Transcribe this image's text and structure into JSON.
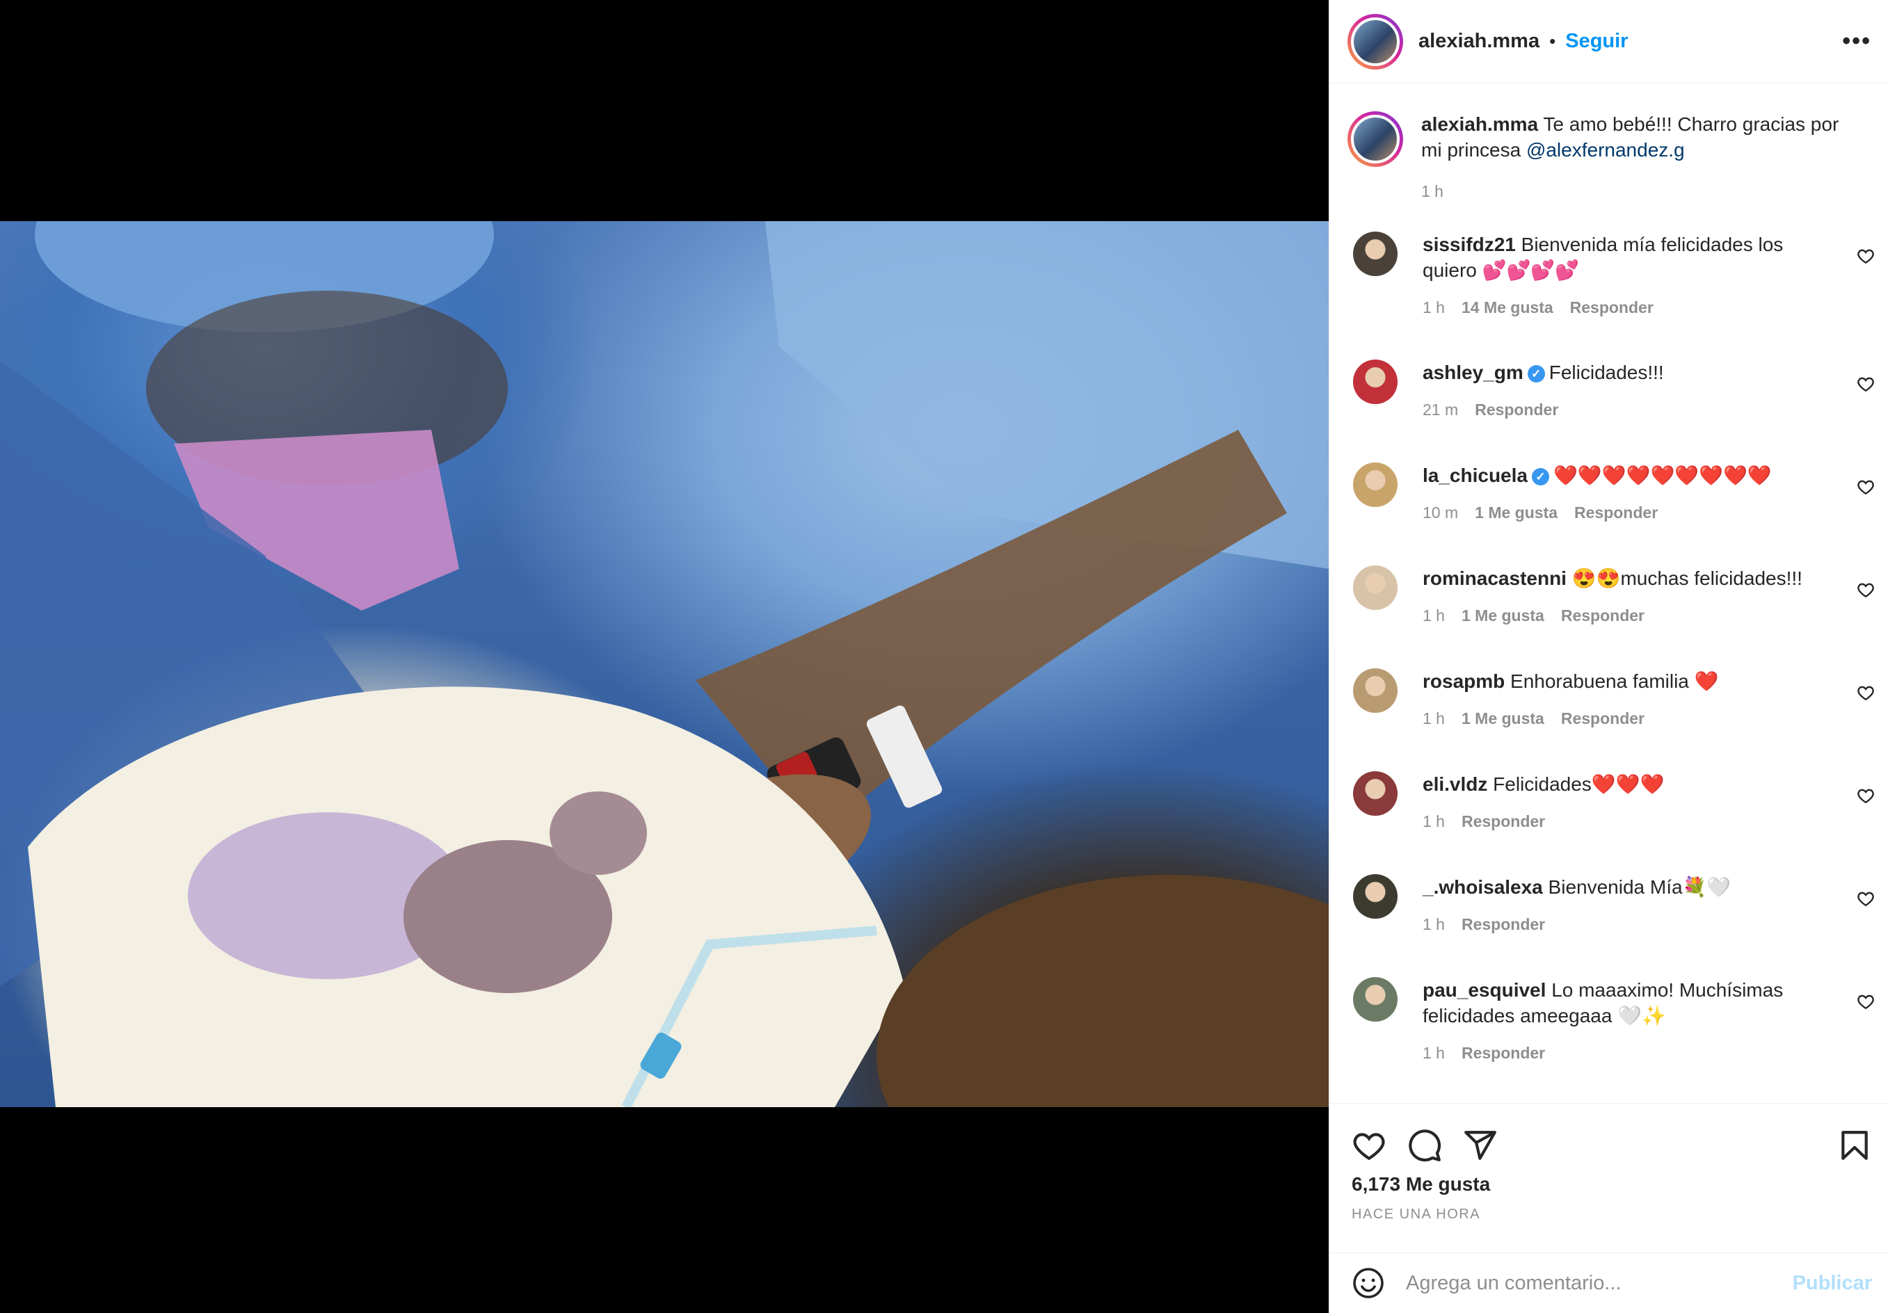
{
  "post": {
    "username": "alexiah.mma",
    "follow_label": "Seguir",
    "dot": "•",
    "more_label": "•••"
  },
  "caption": {
    "username": "alexiah.mma",
    "text": "Te amo bebé!!! Charro gracias por mi princesa ",
    "mention": "@alexfernandez.g",
    "time": "1 h"
  },
  "comments": [
    {
      "username": "sissifdz21",
      "verified": false,
      "text": "Bienvenida mía felicidades los quiero 💕💕💕💕",
      "time": "1 h",
      "likes": "14 Me gusta",
      "reply": "Responder",
      "avatar_color": "#4a4238"
    },
    {
      "username": "ashley_gm",
      "verified": true,
      "text": "Felicidades!!!",
      "time": "21 m",
      "likes": "",
      "reply": "Responder",
      "avatar_color": "#c2303a"
    },
    {
      "username": "la_chicuela",
      "verified": true,
      "text": "❤️❤️❤️❤️❤️❤️❤️❤️❤️",
      "time": "10 m",
      "likes": "1 Me gusta",
      "reply": "Responder",
      "avatar_color": "#c9a46a"
    },
    {
      "username": "rominacastenni",
      "verified": false,
      "text": "😍😍muchas felicidades!!!",
      "time": "1 h",
      "likes": "1 Me gusta",
      "reply": "Responder",
      "avatar_color": "#d8c3a8"
    },
    {
      "username": "rosapmb",
      "verified": false,
      "text": "Enhorabuena familia ❤️",
      "time": "1 h",
      "likes": "1 Me gusta",
      "reply": "Responder",
      "avatar_color": "#b99b72"
    },
    {
      "username": "eli.vldz",
      "verified": false,
      "text": "Felicidades❤️❤️❤️",
      "time": "1 h",
      "likes": "",
      "reply": "Responder",
      "avatar_color": "#8a3a3a"
    },
    {
      "username": "_.whoisalexa",
      "verified": false,
      "text": "Bienvenida Mía💐🤍",
      "time": "1 h",
      "likes": "",
      "reply": "Responder",
      "avatar_color": "#3d3a30"
    },
    {
      "username": "pau_esquivel",
      "verified": false,
      "text": "Lo maaaximo! Muchísimas felicidades ameegaaa 🤍✨",
      "time": "1 h",
      "likes": "",
      "reply": "Responder",
      "avatar_color": "#6b7a64"
    }
  ],
  "footer": {
    "likes": "6,173 Me gusta",
    "ago": "HACE UNA HORA",
    "comment_placeholder": "Agrega un comentario...",
    "publish_label": "Publicar"
  },
  "colors": {
    "accent": "#0095f6",
    "publish_disabled": "#b2dffc",
    "verified": "#3897f0"
  },
  "icons": [
    "more-options-icon",
    "like-icon",
    "comment-icon",
    "share-icon",
    "save-icon",
    "emoji-icon"
  ]
}
